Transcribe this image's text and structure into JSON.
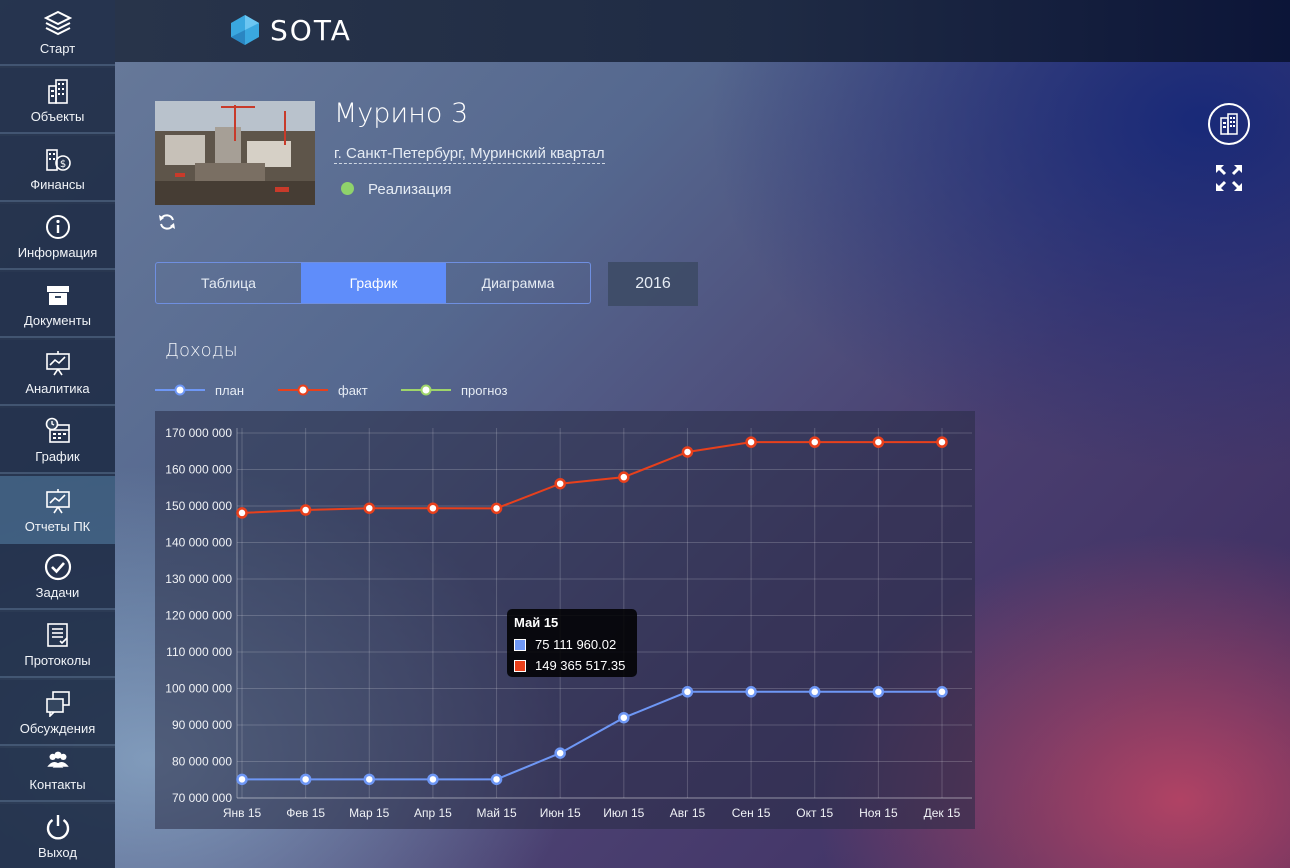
{
  "brand": {
    "name": "SOTA",
    "logo_color": "#3aa8e0"
  },
  "sidebar": {
    "items": [
      {
        "label": "Старт",
        "icon": "layers-icon"
      },
      {
        "label": "Объекты",
        "icon": "buildings-icon"
      },
      {
        "label": "Финансы",
        "icon": "finance-icon"
      },
      {
        "label": "Информация",
        "icon": "info-icon"
      },
      {
        "label": "Документы",
        "icon": "archive-icon"
      },
      {
        "label": "Аналитика",
        "icon": "presentation-icon"
      },
      {
        "label": "График",
        "icon": "calendar-clock-icon"
      },
      {
        "label": "Отчеты ПК",
        "icon": "presentation-icon",
        "active": true
      },
      {
        "label": "Задачи",
        "icon": "check-circle-icon"
      },
      {
        "label": "Протоколы",
        "icon": "protocol-icon"
      },
      {
        "label": "Обсуждения",
        "icon": "chat-windows-icon"
      },
      {
        "label": "Контакты",
        "icon": "contacts-icon"
      },
      {
        "label": "Выход",
        "icon": "power-icon"
      }
    ]
  },
  "project": {
    "title": "Мурино 3",
    "address": "г. Санкт-Петербург, Муринский квартал",
    "status": "Реализация",
    "status_color": "#8fd36b"
  },
  "tabs": [
    {
      "label": "Таблица"
    },
    {
      "label": "График",
      "active": true
    },
    {
      "label": "Диаграмма"
    }
  ],
  "year": "2016",
  "section": {
    "title": "Доходы"
  },
  "legend": [
    {
      "label": "план",
      "color": "#6e97f5"
    },
    {
      "label": "факт",
      "color": "#e8401c"
    },
    {
      "label": "прогноз",
      "color": "#9ed46a"
    }
  ],
  "chart_data": {
    "type": "line",
    "categories": [
      "Янв 15",
      "Фев 15",
      "Мар 15",
      "Апр 15",
      "Май 15",
      "Июн 15",
      "Июл 15",
      "Авг 15",
      "Сен 15",
      "Окт 15",
      "Ноя 15",
      "Дек 15"
    ],
    "series": [
      {
        "name": "план",
        "color": "#6e97f5",
        "values": [
          75111960,
          75111960,
          75111960,
          75111960,
          75111960.02,
          82300000,
          92000000,
          99100000,
          99100000,
          99100000,
          99100000,
          99100000
        ]
      },
      {
        "name": "факт",
        "color": "#e8401c",
        "values": [
          148100000,
          148900000,
          149400000,
          149400000,
          149365517.35,
          156100000,
          157900000,
          164800000,
          167500000,
          167500000,
          167500000,
          167500000
        ]
      }
    ],
    "y_ticks": [
      "170 000 000",
      "160 000 000",
      "150 000 000",
      "140 000 000",
      "130 000 000",
      "120 000 000",
      "110 000 000",
      "100 000 000",
      "90 000 000",
      "80 000 000",
      "70 000 000"
    ],
    "ylim": [
      70000000,
      170000000
    ],
    "grid": true,
    "legend_position": "top-left",
    "tooltip": {
      "title": "Май 15",
      "rows": [
        {
          "value": "75 111 960.02",
          "color": "#6e97f5"
        },
        {
          "value": "149 365 517.35",
          "color": "#e8401c"
        }
      ]
    }
  }
}
